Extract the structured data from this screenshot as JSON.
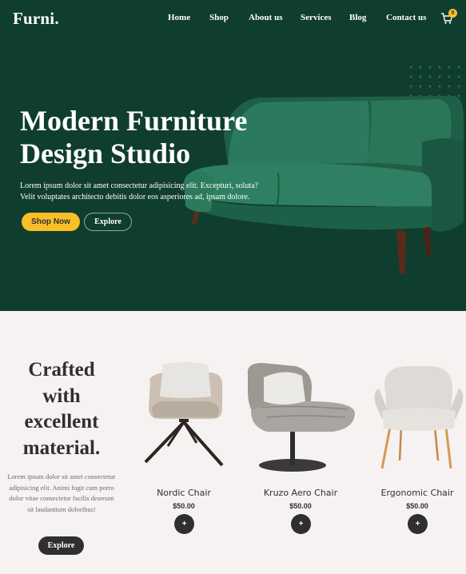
{
  "header": {
    "brand": "Furni.",
    "nav": [
      "Home",
      "Shop",
      "About us",
      "Services",
      "Blog",
      "Contact us"
    ],
    "cart_count": "0",
    "cart_icon": "cart-icon"
  },
  "hero": {
    "title": "Modern Furniture Design Studio",
    "text": "Lorem ipsum dolor sit amet consectetur adipisicing elit. Excepturi, soluta? Velit voluptates architecto debitis dolor eos asperiores ad, ipsam dolore.",
    "primary_button": "Shop Now",
    "secondary_button": "Explore",
    "background_color": "#103e2e",
    "accent_color": "#f9bf29"
  },
  "section": {
    "title": "Crafted with excellent material.",
    "text": "Lorem ipsum dolor sit amet consectetur adipisicing elit. Animi fugit cum porro dolor vitae consectetur facilis deserunt sit laudantium doloribus!",
    "button": "Explore"
  },
  "products": [
    {
      "name": "Nordic Chair",
      "price": "$50.00",
      "add_label": "+"
    },
    {
      "name": "Kruzo Aero Chair",
      "price": "$50.00",
      "add_label": "+"
    },
    {
      "name": "Ergonomic Chair",
      "price": "$50.00",
      "add_label": "+"
    }
  ]
}
